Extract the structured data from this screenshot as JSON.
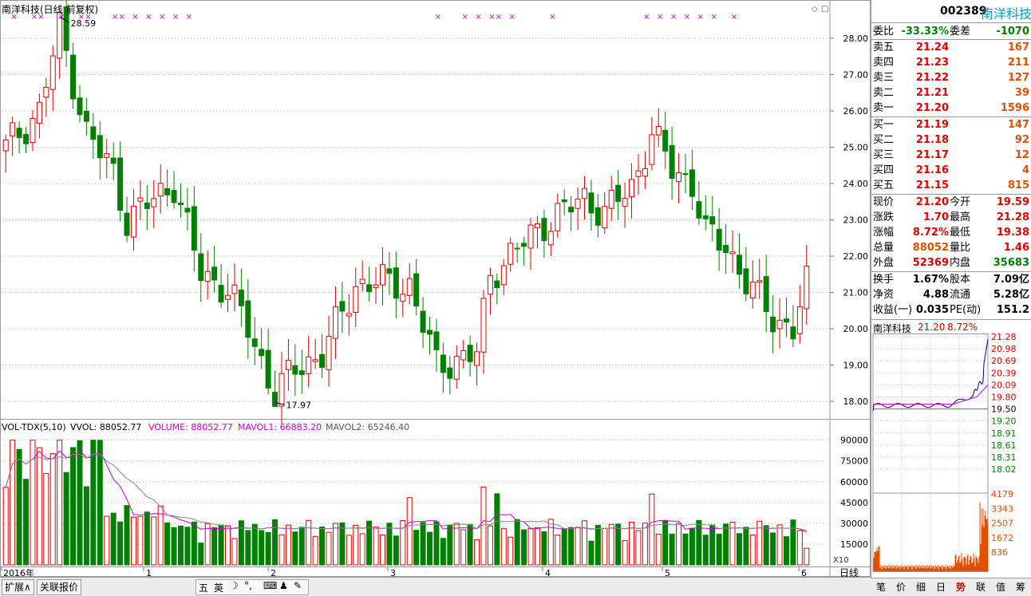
{
  "main_title": "南洋科技(日线 前复权)",
  "price_axis": [
    "28.00",
    "27.00",
    "26.00",
    "25.00",
    "24.00",
    "23.00",
    "22.00",
    "21.00",
    "20.00",
    "19.00",
    "18.00"
  ],
  "high_label": "28.59",
  "low_label": "17.97",
  "vol_indicator": {
    "name": "VOL-TDX(5,10)",
    "vvol": "VVOL: 88052.77",
    "volume": "VOLUME: 88052.77",
    "mavol1": "MAVOL1: 66883.20",
    "mavol2": "MAVOL2: 65246.40"
  },
  "vol_axis": [
    "90000",
    "75000",
    "60000",
    "45000",
    "30000",
    "15000"
  ],
  "vol_unit": "X10",
  "date_axis": [
    "2016年",
    "1",
    "2",
    "3",
    "4",
    "5",
    "6"
  ],
  "period_label": "日线",
  "bottom_tabs": [
    "扩展∧",
    "关联报价"
  ],
  "ime_items": [
    "五",
    "英"
  ],
  "quote": {
    "code": "002389",
    "name": "南洋科技",
    "weibi_label": "委比",
    "weibi": "-33.33%",
    "weicha_label": "委差",
    "weicha": "-1070",
    "asks": [
      {
        "label": "卖五",
        "price": "21.24",
        "vol": "167"
      },
      {
        "label": "卖四",
        "price": "21.23",
        "vol": "211"
      },
      {
        "label": "卖三",
        "price": "21.22",
        "vol": "127"
      },
      {
        "label": "卖二",
        "price": "21.21",
        "vol": "39"
      },
      {
        "label": "卖一",
        "price": "21.20",
        "vol": "1596"
      }
    ],
    "bids": [
      {
        "label": "买一",
        "price": "21.19",
        "vol": "147"
      },
      {
        "label": "买二",
        "price": "21.18",
        "vol": "92"
      },
      {
        "label": "买三",
        "price": "21.17",
        "vol": "12"
      },
      {
        "label": "买四",
        "price": "21.16",
        "vol": "4"
      },
      {
        "label": "买五",
        "price": "21.15",
        "vol": "815"
      }
    ],
    "stats": [
      {
        "l1": "现价",
        "v1": "21.20",
        "c1": "red",
        "l2": "今开",
        "v2": "19.59",
        "c2": "red"
      },
      {
        "l1": "涨跌",
        "v1": "1.70",
        "c1": "red",
        "l2": "最高",
        "v2": "21.28",
        "c2": "red"
      },
      {
        "l1": "涨幅",
        "v1": "8.72%",
        "c1": "red",
        "l2": "最低",
        "v2": "19.38",
        "c2": "red"
      },
      {
        "l1": "总量",
        "v1": "88052",
        "c1": "org",
        "l2": "量比",
        "v2": "1.46",
        "c2": "red"
      },
      {
        "l1": "外盘",
        "v1": "52369",
        "c1": "red",
        "l2": "内盘",
        "v2": "35683",
        "c2": "grn"
      }
    ],
    "stats2": [
      {
        "l1": "换手",
        "v1": "1.67%",
        "l2": "股本",
        "v2": "7.09亿"
      },
      {
        "l1": "净资",
        "v1": "4.88",
        "l2": "流通",
        "v2": "5.28亿"
      },
      {
        "l1": "收益(一)",
        "v1": "0.035",
        "l2": "PE(动)",
        "v2": "151.2"
      }
    ],
    "mini_title": "南洋科技",
    "mini_price": "21.20",
    "mini_pct": "8.72%",
    "mini_price_axis": [
      "21.28",
      "20.98",
      "20.69",
      "20.39",
      "20.09",
      "19.80",
      "19.50",
      "19.20",
      "18.91",
      "18.61",
      "18.31",
      "18.02"
    ],
    "mini_vol_axis": [
      "4179",
      "3343",
      "2507",
      "1672",
      "836"
    ],
    "tabs": [
      "笔",
      "价",
      "细",
      "日",
      "势",
      "联",
      "值",
      "筹"
    ]
  },
  "colors": {
    "up": "#e00000",
    "down": "#008000",
    "ma1": "#cc00cc",
    "ma2": "#888888",
    "accent": "#00a0c0"
  }
}
